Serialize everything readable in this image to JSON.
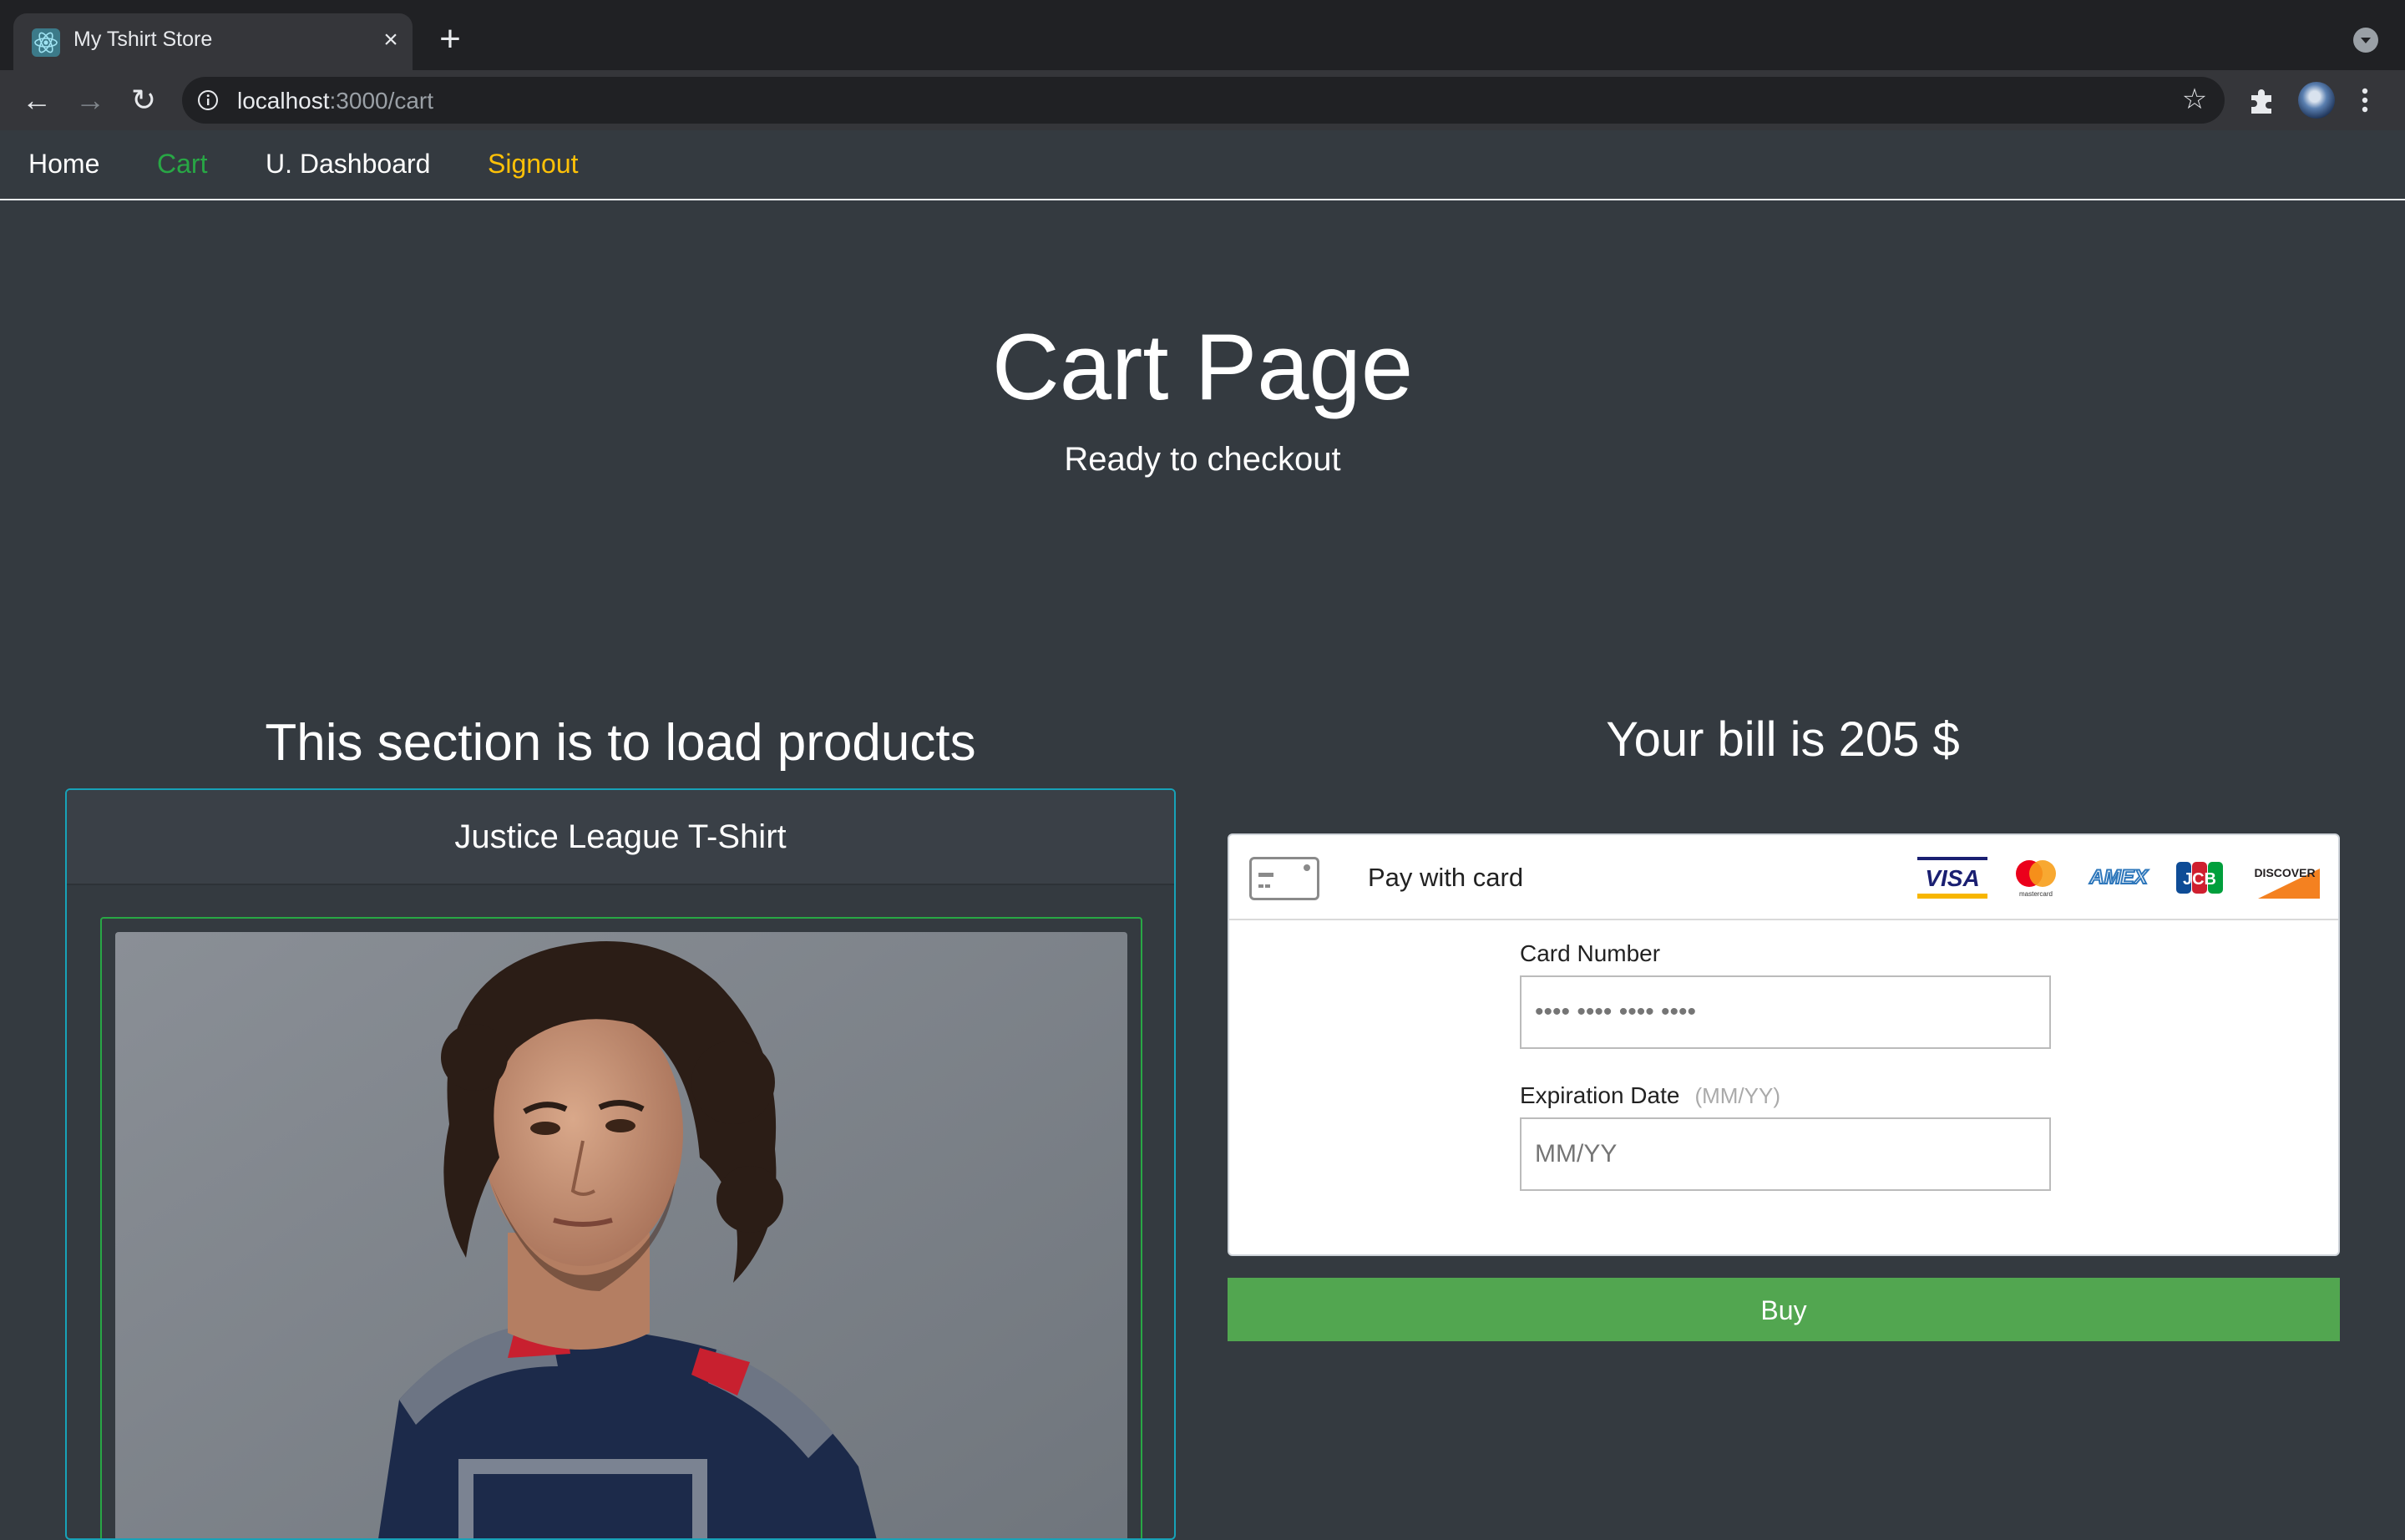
{
  "browser": {
    "tab_title": "My Tshirt Store",
    "url_host": "localhost",
    "url_path": ":3000/cart",
    "icons": [
      "react-favicon-icon",
      "close-icon",
      "plus-icon",
      "back-icon",
      "forward-icon",
      "reload-icon",
      "info-icon",
      "star-icon",
      "puzzle-icon",
      "avatar",
      "kebab-icon",
      "tab-search-icon"
    ]
  },
  "nav": {
    "home": "Home",
    "cart": "Cart",
    "dashboard": "U. Dashboard",
    "signout": "Signout",
    "colors": {
      "default": "#ffffff",
      "active": "#28a745",
      "warning": "#ffc107"
    }
  },
  "hero": {
    "title": "Cart Page",
    "subtitle": "Ready to checkout"
  },
  "products": {
    "heading": "This section is to load products",
    "items": [
      {
        "name": "Justice League T-Shirt"
      }
    ]
  },
  "checkout": {
    "bill": "Your bill is 205 $",
    "pay_with_card": "Pay with card",
    "brands": [
      "VISA",
      "mastercard",
      "AMEX",
      "JCB",
      "DISCOVER"
    ],
    "card_number_label": "Card Number",
    "card_number_placeholder": "•••• •••• •••• ••••",
    "expiry_label": "Expiration Date",
    "expiry_hint": "(MM/YY)",
    "expiry_placeholder": "MM/YY",
    "buy_label": "Buy",
    "buy_color": "#52a650"
  }
}
